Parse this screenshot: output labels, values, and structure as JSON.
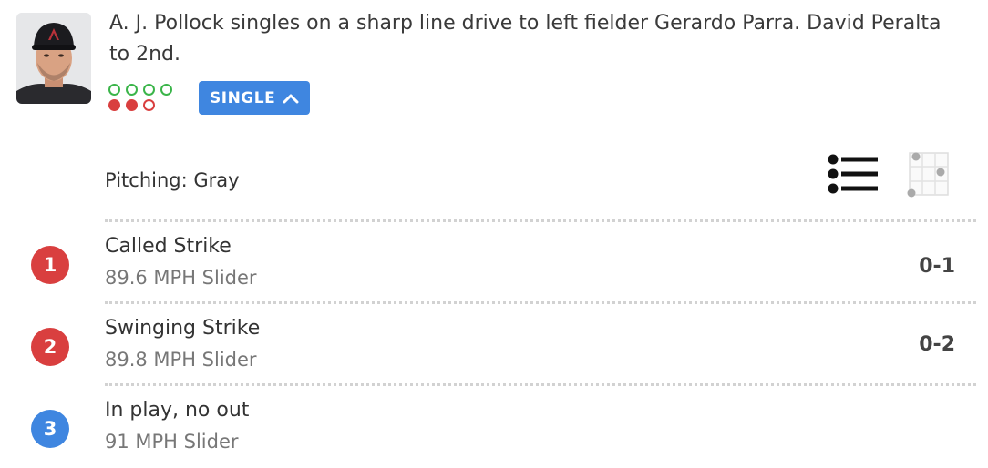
{
  "play": {
    "description": "A. J. Pollock singles on a sharp line drive to left fielder Gerardo Parra. David Peralta to 2nd.",
    "result_label": "SINGLE",
    "balls": {
      "shown": 4,
      "filled": 0
    },
    "strikes": {
      "shown": 3,
      "filled": 2
    }
  },
  "pitching": {
    "label": "Pitching: Gray"
  },
  "colors": {
    "ball": "#3bb54a",
    "strike": "#d93f3f",
    "in_play": "#3f86e0",
    "badge": "#3f86e0"
  },
  "pitches": [
    {
      "number": "1",
      "result": "Called Strike",
      "detail": "89.6 MPH Slider",
      "count": "0-1",
      "color": "#d93f3f"
    },
    {
      "number": "2",
      "result": "Swinging Strike",
      "detail": "89.8 MPH Slider",
      "count": "0-2",
      "color": "#d93f3f"
    },
    {
      "number": "3",
      "result": "In play, no out",
      "detail": "91 MPH Slider",
      "count": "",
      "color": "#3f86e0"
    }
  ],
  "icons": {
    "player": "player-headshot",
    "badge_toggle": "chevron-up-icon",
    "list_view": "list-view-icon",
    "zone_view": "strike-zone-view-icon"
  }
}
